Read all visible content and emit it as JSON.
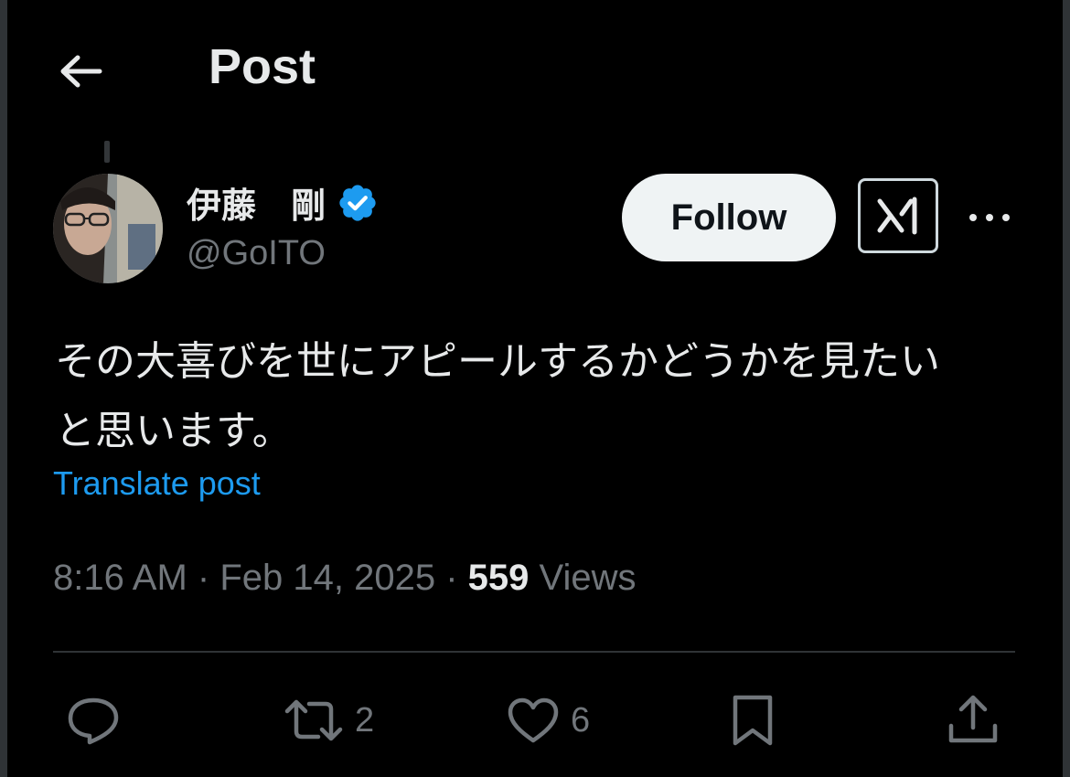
{
  "header": {
    "title": "Post"
  },
  "author": {
    "display_name": "伊藤　剛",
    "handle": "@GoITO",
    "verified": true
  },
  "follow_button": {
    "label": "Follow"
  },
  "affiliate_badge": {
    "icon": "x-ai-logo-icon"
  },
  "post": {
    "text_lines": [
      "その大喜びを世にアピールするかどうかを見たい",
      "と思います。"
    ],
    "translate_label": "Translate post"
  },
  "meta": {
    "time": "8:16 AM",
    "date": "Feb 14, 2025",
    "views_count": "559",
    "views_label": "Views",
    "separator": "·"
  },
  "actions": {
    "reply": {
      "icon": "reply-icon",
      "count": ""
    },
    "repost": {
      "icon": "repost-icon",
      "count": "2"
    },
    "like": {
      "icon": "heart-icon",
      "count": "6"
    },
    "bookmark": {
      "icon": "bookmark-icon",
      "count": ""
    },
    "share": {
      "icon": "share-icon",
      "count": ""
    }
  },
  "colors": {
    "background": "#000000",
    "text_primary": "#e7e9ea",
    "text_secondary": "#71767b",
    "link": "#1d9bf0",
    "verified": "#1d9bf0",
    "follow_bg": "#eff3f4"
  }
}
